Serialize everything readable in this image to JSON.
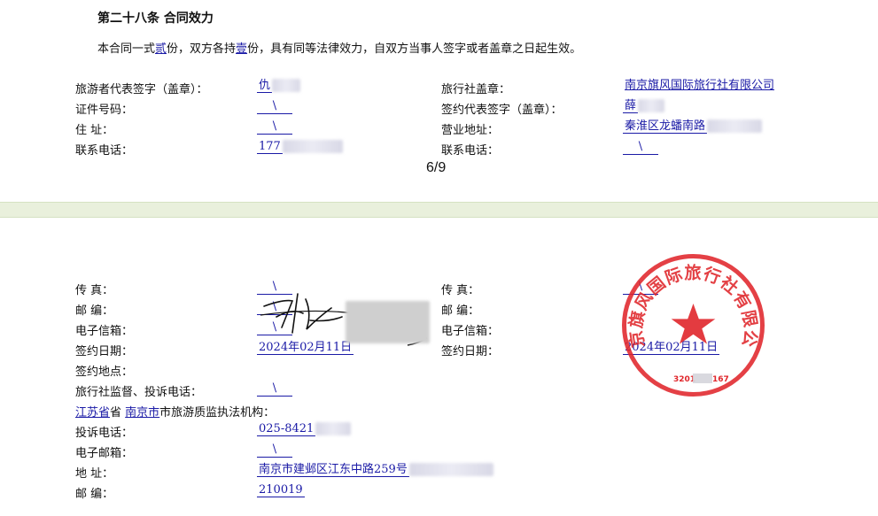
{
  "title": "第二十八条 合同效力",
  "para": {
    "pre": "本合同一式",
    "copies": "贰",
    "mid": "份，双方各持",
    "each": "壹",
    "post": "份，具有同等法律效力，自双方当事人签字或者盖章之日起生效。"
  },
  "page_number": "6/9",
  "top_left": {
    "rows": [
      {
        "label": "旅游者代表签字（盖章）：",
        "value": "仇"
      },
      {
        "label": "证件号码：",
        "value": "\\"
      },
      {
        "label": "住    址：",
        "value": "\\"
      },
      {
        "label": "联系电话：",
        "value": "177"
      }
    ]
  },
  "top_right": {
    "rows": [
      {
        "label": "旅行社盖章：",
        "value": "南京旗风国际旅行社有限公司"
      },
      {
        "label": "签约代表签字（盖章）：",
        "value": "薛"
      },
      {
        "label": "营业地址：",
        "value": "秦淮区龙蟠南路"
      },
      {
        "label": "联系电话：",
        "value": "\\"
      }
    ]
  },
  "bottom_left": {
    "fax_label": "传    真：",
    "fax_value": "\\",
    "postcode_label": "邮    编：",
    "postcode_value": "\\",
    "email_label": "电子信箱：",
    "email_value": "\\",
    "date_label": "签约日期：",
    "date_value": "2024年02月11日",
    "place_label": "签约地点：",
    "complaint_label": "旅行社监督、投诉电话：",
    "complaint_value": "\\",
    "province": "江苏省",
    "province_suffix": "省",
    "city": "南京市",
    "authority_suffix": "市旅游质监执法机构：",
    "phone_label": "投诉电话：",
    "phone_value": "025-8421",
    "mail_label": "电子邮箱：",
    "mail_value": "\\",
    "addr_label": "地    址：",
    "addr_value": "南京市建邺区江东中路259号",
    "zip_label": "邮    编：",
    "zip_value": "210019"
  },
  "bottom_right": {
    "fax_label": "传    真：",
    "fax_value": "\\",
    "postcode_label": "邮    编：",
    "email_label": "电子信箱：",
    "date_label": "签约日期：",
    "date_value": "2024年02月11日"
  },
  "seal": {
    "text": "南京旗风国际旅行社有限公司",
    "number_pre": "3201",
    "number_post": "167",
    "color": "#e0262b"
  },
  "colors": {
    "link": "#1a1aa6",
    "band": "#e9f0dc"
  }
}
